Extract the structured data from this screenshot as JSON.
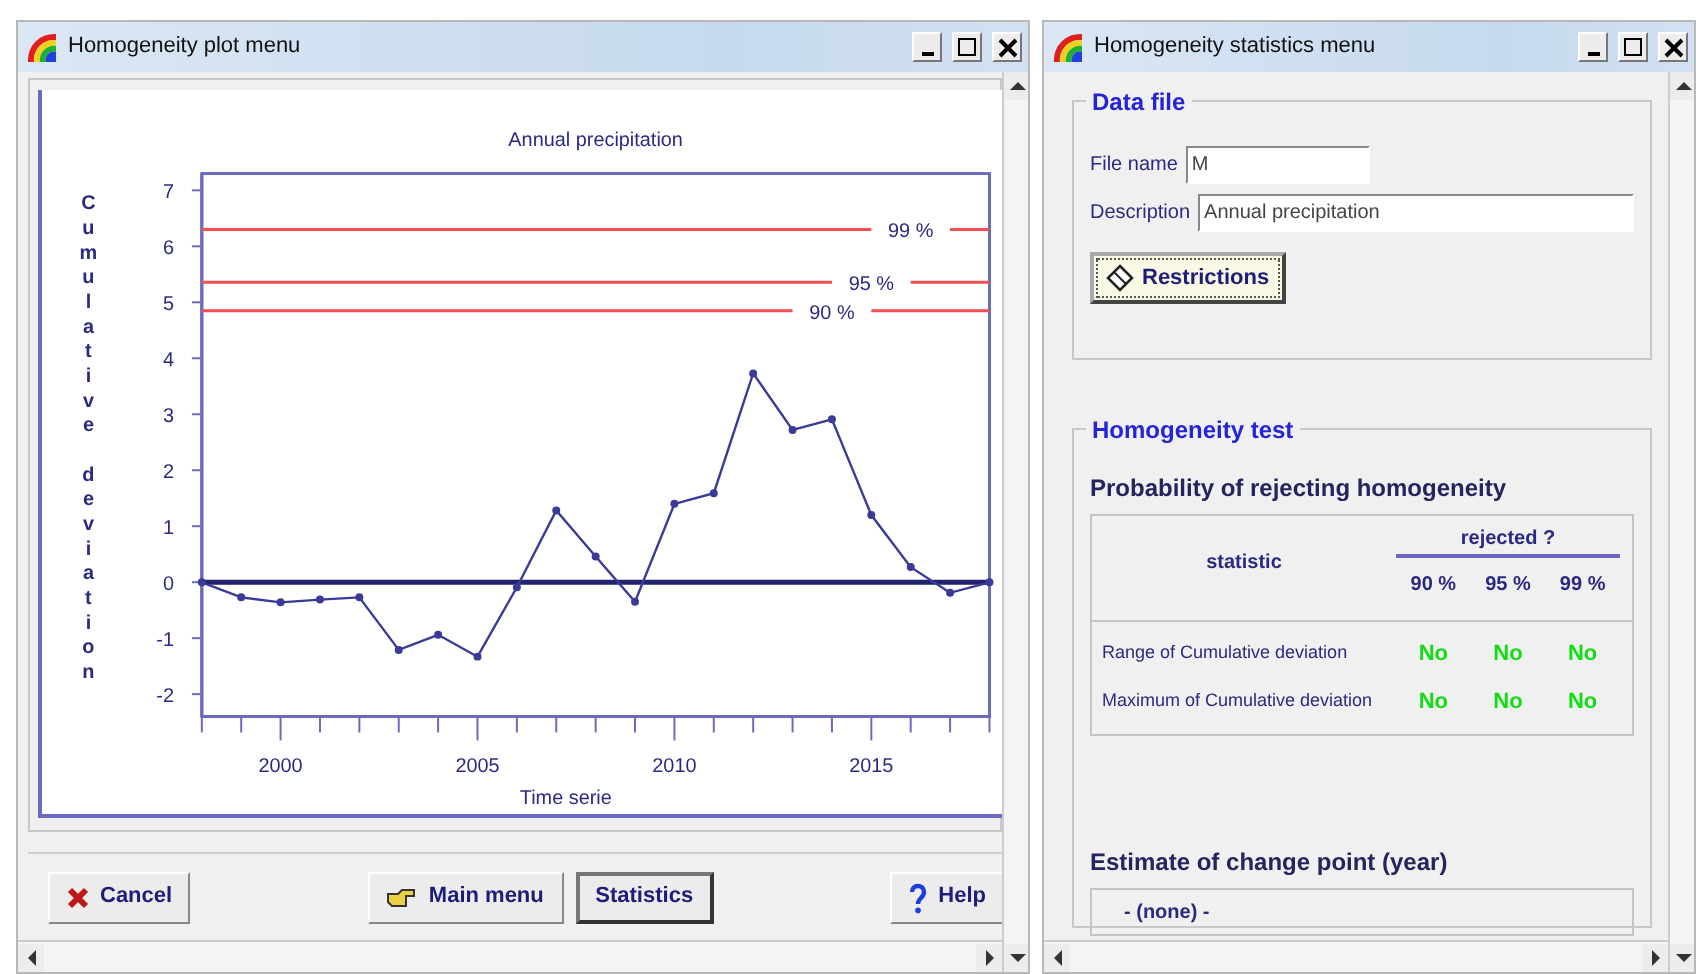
{
  "plot_window": {
    "title": "Homogeneity plot menu",
    "chart": {
      "chart_data": {
        "type": "line",
        "title": "Annual precipitation",
        "xlabel": "Time serie",
        "ylabel": "Cumulative deviation",
        "x": [
          1998,
          1999,
          2000,
          2001,
          2002,
          2003,
          2004,
          2005,
          2006,
          2007,
          2008,
          2009,
          2010,
          2011,
          2012,
          2013,
          2014,
          2015,
          2016,
          2017,
          2018
        ],
        "series": [
          {
            "color": "#3a3a98",
            "marker": "circle",
            "values": [
              0,
              -0.27,
              -0.36,
              -0.31,
              -0.27,
              -1.21,
              -0.94,
              -1.33,
              -0.09,
              1.28,
              0.46,
              -0.35,
              1.4,
              1.59,
              3.73,
              2.72,
              2.91,
              1.2,
              0.27,
              -0.19,
              0
            ]
          },
          {
            "color": "#22226e",
            "values": [
              0,
              0,
              0,
              0,
              0,
              0,
              0,
              0,
              0,
              0,
              0,
              0,
              0,
              0,
              0,
              0,
              0,
              0,
              0,
              0,
              0
            ]
          },
          {
            "name": "99 %",
            "color": "#f05050",
            "values": [
              6.3,
              6.3,
              6.3,
              6.3,
              6.3,
              6.3,
              6.3,
              6.3,
              6.3,
              6.3,
              6.3,
              6.3,
              6.3,
              6.3,
              6.3,
              6.3,
              6.3,
              6.3,
              null,
              6.3,
              6.3
            ]
          },
          {
            "name": "95 %",
            "color": "#f05050",
            "values": [
              5.36,
              5.36,
              5.36,
              5.36,
              5.36,
              5.36,
              5.36,
              5.36,
              5.36,
              5.36,
              5.36,
              5.36,
              5.36,
              5.36,
              5.36,
              5.36,
              5.36,
              null,
              5.36,
              5.36,
              5.36
            ]
          },
          {
            "name": "90 %",
            "color": "#f05050",
            "values": [
              4.85,
              4.85,
              4.85,
              4.85,
              4.85,
              4.85,
              4.85,
              4.85,
              4.85,
              4.85,
              4.85,
              4.85,
              4.85,
              4.85,
              4.85,
              4.85,
              null,
              4.85,
              4.85,
              4.85,
              4.85
            ]
          }
        ],
        "xlim": [
          1998,
          2018
        ],
        "ylim": [
          -2.4,
          7.3
        ],
        "xticks": [
          2000,
          2005,
          2010,
          2015
        ],
        "yticks": [
          -2,
          -1,
          0,
          1,
          2,
          3,
          4,
          5,
          6,
          7
        ]
      }
    },
    "buttons": [
      {
        "kind": "cancel",
        "label": "Cancel",
        "default": false
      },
      {
        "kind": "main-menu",
        "label": "Main menu",
        "default": false
      },
      {
        "kind": "plain",
        "label": "Statistics",
        "default": true
      },
      {
        "kind": "help",
        "label": "Help",
        "default": false
      }
    ]
  },
  "stats_window": {
    "title": "Homogeneity statistics menu",
    "data_file": {
      "legend": "Data file",
      "fields": [
        {
          "label": "File name",
          "value": "M"
        },
        {
          "label": "Description",
          "value": "Annual precipitation"
        }
      ],
      "button": {
        "label": "Restrictions",
        "focused": true
      }
    },
    "homogeneity_test": {
      "legend": "Homogeneity test",
      "heading": "Probability of rejecting homogeneity",
      "table": {
        "group_header": "rejected ?",
        "columns": [
          "statistic",
          "90 %",
          "95 %",
          "99 %"
        ],
        "rows": [
          {
            "statistic": "Range of Cumulative deviation",
            "values": [
              "No",
              "No",
              "No"
            ]
          },
          {
            "statistic": "Maximum of Cumulative deviation",
            "values": [
              "No",
              "No",
              "No"
            ]
          }
        ]
      },
      "change_point": {
        "heading": "Estimate of change point (year)",
        "value": "- (none) -"
      }
    }
  }
}
